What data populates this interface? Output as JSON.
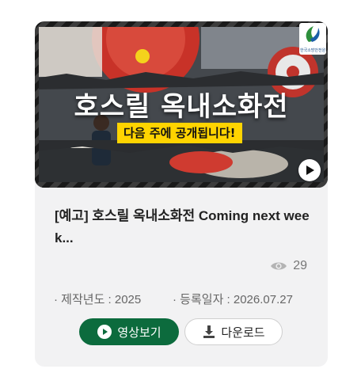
{
  "thumbnail": {
    "overlay_title": "호스릴 옥내소화전",
    "overlay_subtitle": "다음 주에 공개됩니다!",
    "logo_text": "한국소방안전원",
    "accent_yellow": "#ffd400"
  },
  "video": {
    "title": "[예고] 호스릴 옥내소화전 Coming next week...",
    "views": "29",
    "production_year": "· 제작년도 : 2025",
    "registration_date": "· 등록일자 : 2026.07.27"
  },
  "actions": {
    "play_label": "영상보기",
    "download_label": "다운로드",
    "play_color": "#0c6b3d"
  },
  "icons": {
    "thumbnail_play": "play-icon",
    "views": "eye-icon",
    "play_button": "play-circle-icon",
    "download_button": "download-icon"
  }
}
